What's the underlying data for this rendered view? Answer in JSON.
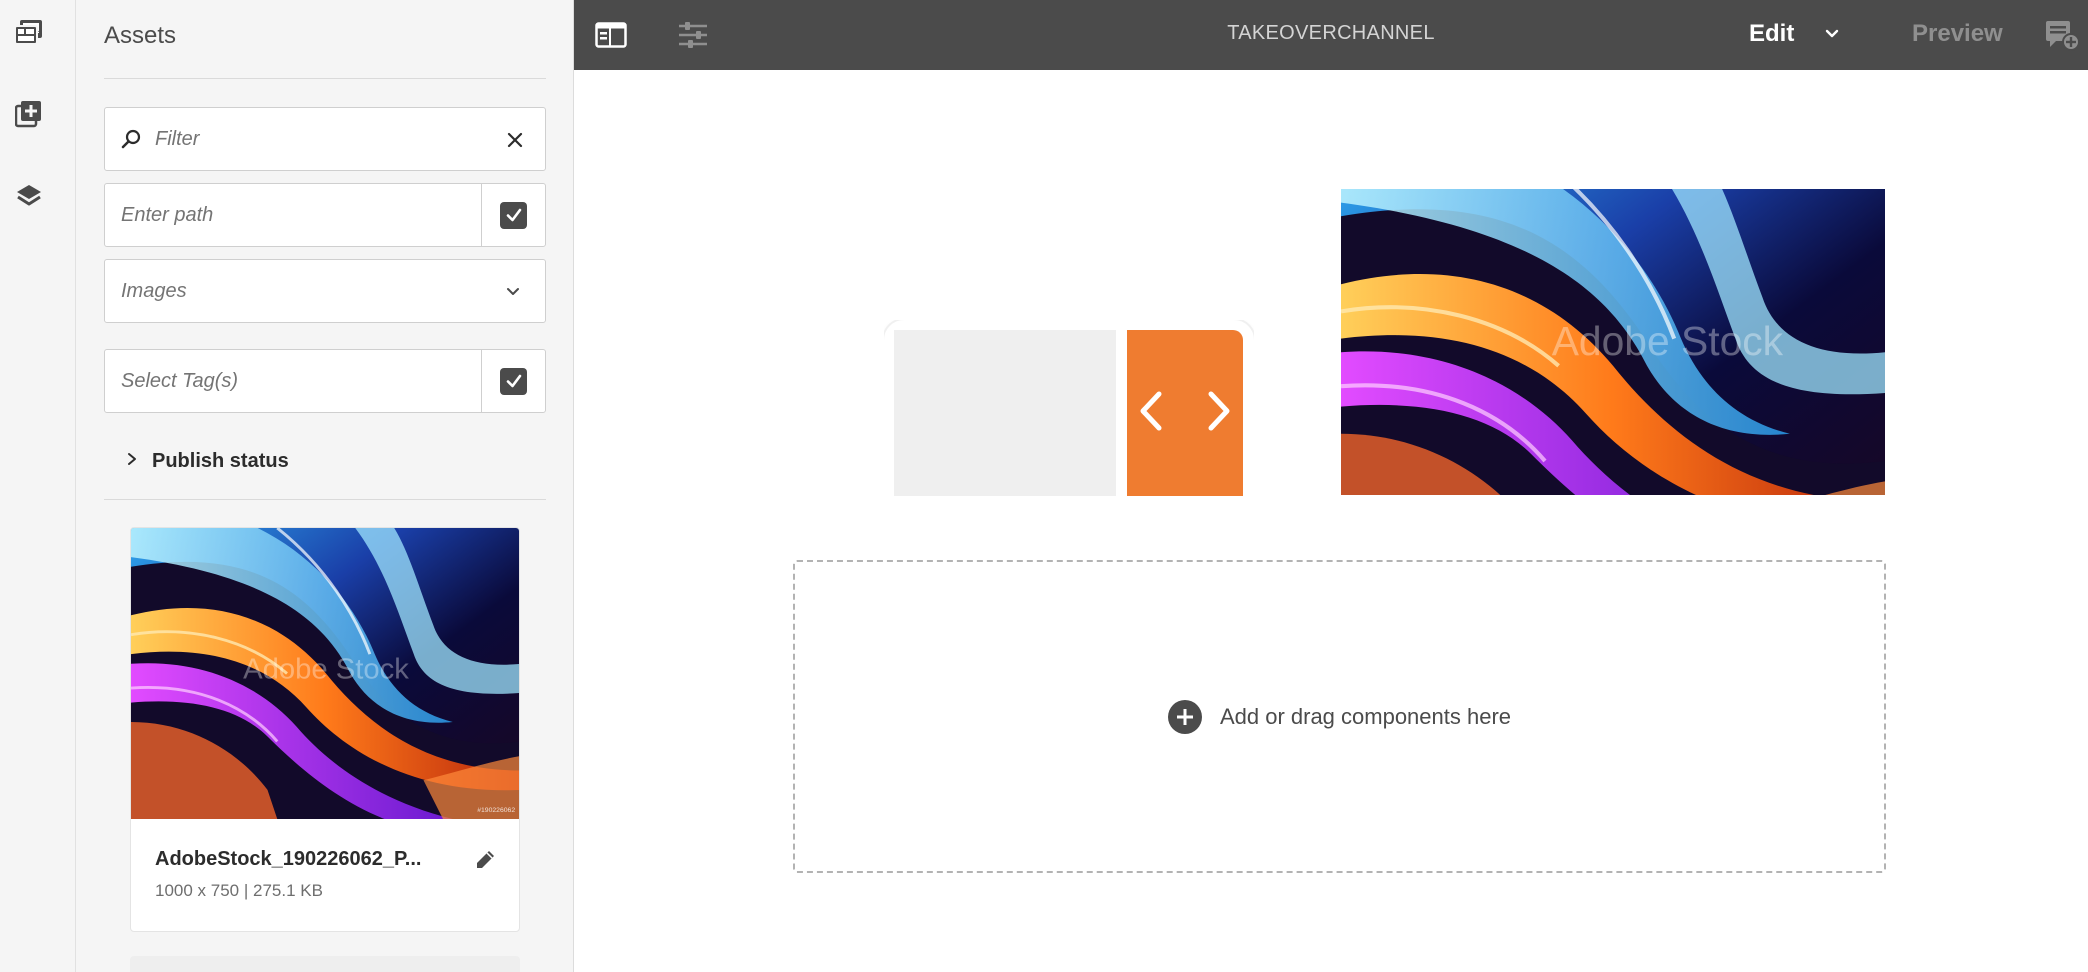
{
  "app": {
    "page_title": "TAKEOVERCHANNEL",
    "mode": {
      "edit_label": "Edit",
      "preview_label": "Preview"
    }
  },
  "rail": {
    "items": [
      {
        "icon": "asset-library-icon"
      },
      {
        "icon": "add-component-icon"
      },
      {
        "icon": "layers-icon"
      }
    ]
  },
  "assets_panel": {
    "title": "Assets",
    "filter": {
      "placeholder": "Filter",
      "value": ""
    },
    "path": {
      "placeholder": "Enter path",
      "value": ""
    },
    "type_select": {
      "selected": "Images"
    },
    "tags": {
      "placeholder": "Select Tag(s)",
      "value": ""
    },
    "publish_status_label": "Publish status",
    "assets": [
      {
        "name": "AdobeStock_190226062_P...",
        "meta": "1000 x 750 | 275.1 KB",
        "watermark": "Adobe Stock",
        "stock_id": "#190226062"
      }
    ]
  },
  "canvas": {
    "hero_watermark": "Adobe Stock",
    "dropzone_label": "Add or drag components here"
  },
  "colors": {
    "toolbar_bg": "#4b4b4b",
    "panel_bg": "#f5f5f5",
    "carousel_nav": "#ef7c30"
  }
}
